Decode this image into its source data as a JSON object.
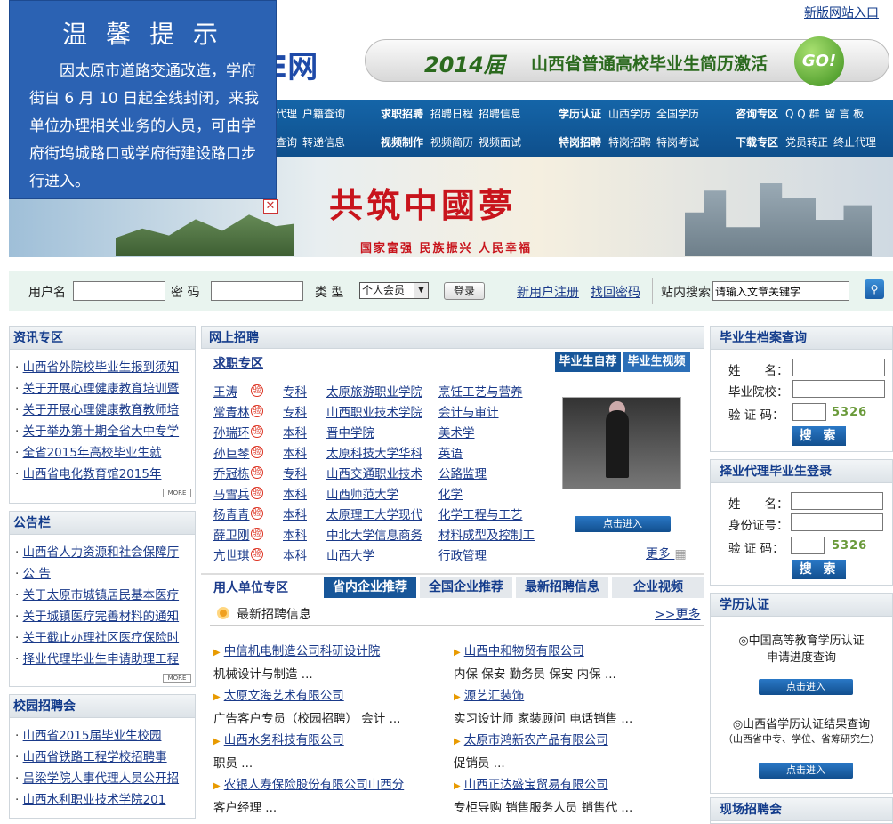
{
  "top_link": "新版网站入口",
  "logo_fragment": "E网",
  "banner": {
    "year": "2014届",
    "text": "山西省普通高校毕业生简历激活",
    "go": "GO!"
  },
  "nav": {
    "g1": {
      "r1": [
        "代理",
        "户籍查询"
      ],
      "r2": [
        "查询",
        "转递信息"
      ]
    },
    "g2": {
      "h1": "求职招聘",
      "r1": [
        "招聘日程",
        "招聘信息"
      ],
      "h2": "视频制作",
      "r2": [
        "视频简历",
        "视频面试"
      ]
    },
    "g3": {
      "h1": "学历认证",
      "r1": [
        "山西学历",
        "全国学历"
      ],
      "h2": "特岗招聘",
      "r2": [
        "特岗招聘",
        "特岗考试"
      ]
    },
    "g4": {
      "h1": "咨询专区",
      "r1": [
        "Q Q 群",
        "留 言 板"
      ],
      "h2": "下载专区",
      "r2": [
        "党员转正",
        "终止代理"
      ]
    }
  },
  "dream": {
    "title": "共筑中國夢",
    "slogan": "国家富强  民族振兴  人民幸福"
  },
  "popup": {
    "title": "温 馨 提 示",
    "message": "因太原市道路交通改造，学府街自 6 月 10 日起全线封闭，来我单位办理相关业务的人员，可由学府街坞城路口或学府街建设路口步行进入。",
    "close": "✕"
  },
  "login": {
    "user_label": "用户名",
    "pwd_label": "密 码",
    "type_label": "类 型",
    "type_value": "个人会员",
    "login_btn": "登录",
    "register": "新用户注册",
    "recover": "找回密码",
    "search_label": "站内搜索",
    "search_placeholder": "请输入文章关键字"
  },
  "news": {
    "title": "资讯专区",
    "items": [
      "山西省外院校毕业生报到须知",
      "关于开展心理健康教育培训暨",
      "关于开展心理健康教育教师培",
      "关于举办第十期全省大中专学",
      "全省2015年高校毕业生就",
      "山西省电化教育馆2015年"
    ],
    "more": "MORE"
  },
  "notice": {
    "title": "公告栏",
    "items": [
      "山西省人力资源和社会保障厅",
      "公 告",
      "关于太原市城镇居民基本医疗",
      "关于城镇医疗完善材料的通知",
      "关于截止办理社区医疗保险时",
      "择业代理毕业生申请助理工程"
    ],
    "more": "MORE"
  },
  "campus": {
    "title": "校园招聘会",
    "items": [
      "山西省2015届毕业生校园",
      "山西省铁路工程学校招聘事",
      "吕梁学院人事代理人员公开招",
      "山西水利职业技术学院201"
    ]
  },
  "recruit": {
    "title": "网上招聘",
    "sub": "求职专区",
    "tabs": [
      "毕业生自荐",
      "毕业生视频"
    ],
    "verify": "验",
    "rows": [
      [
        "王涛",
        "专科",
        "太原旅游职业学院",
        "烹饪工艺与营养"
      ],
      [
        "常青林",
        "专科",
        "山西职业技术学院",
        "会计与审计"
      ],
      [
        "孙瑞环",
        "本科",
        "晋中学院",
        "美术学"
      ],
      [
        "孙巨琴",
        "本科",
        "太原科技大学华科",
        "英语"
      ],
      [
        "乔冠栋",
        "专科",
        "山西交通职业技术",
        "公路监理"
      ],
      [
        "马雪兵",
        "本科",
        "山西师范大学",
        "化学"
      ],
      [
        "杨青青",
        "本科",
        "太原理工大学现代",
        "化学工程与工艺"
      ],
      [
        "薛卫刚",
        "本科",
        "中北大学信息商务",
        "材料成型及控制工"
      ],
      [
        "亢世琪",
        "本科",
        "山西大学",
        "行政管理"
      ]
    ],
    "enter": "点击进入",
    "more": "更多"
  },
  "employer": {
    "title": "用人单位专区",
    "tabs": [
      "省内企业推荐",
      "全国企业推荐",
      "最新招聘信息",
      "企业视频"
    ],
    "latest": "最新招聘信息",
    "more": ">>更多",
    "jobs": [
      {
        "name": "中信机电制造公司科研设计院",
        "desc": "机械设计与制造 ..."
      },
      {
        "name": "山西中和物贸有限公司",
        "desc": "内保  保安  勤务员  保安  内保 ..."
      },
      {
        "name": "太原文海艺术有限公司",
        "desc": "广告客户专员（校园招聘） 会计 ..."
      },
      {
        "name": "源艺汇装饰",
        "desc": "实习设计师  家装顾问  电话销售 ..."
      },
      {
        "name": "山西水务科技有限公司",
        "desc": "职员 ..."
      },
      {
        "name": "太原市鸿新农产品有限公司",
        "desc": "促销员 ..."
      },
      {
        "name": "农银人寿保险股份有限公司山西分",
        "desc": "客户经理 ..."
      },
      {
        "name": "山西正达盛宝贸易有限公司",
        "desc": "专柜导购  销售服务人员  销售代 ..."
      }
    ]
  },
  "archive": {
    "title": "毕业生档案查询",
    "name": "姓　　名：",
    "school": "毕业院校：",
    "code_label": "验 证 码：",
    "code": "5326",
    "btn": "搜 索"
  },
  "agent": {
    "title": "择业代理毕业生登录",
    "name": "姓　　名：",
    "id": "身份证号：",
    "code_label": "验 证 码：",
    "code": "5326",
    "btn": "搜 索"
  },
  "degree": {
    "title": "学历认证",
    "l1": "◎中国高等教育学历认证",
    "l1b": "申请进度查询",
    "enter": "点击进入",
    "l2": "◎山西省学历认证结果查询",
    "l2b": "（山西省中专、学位、省筹研究生）"
  },
  "onsite": {
    "title": "现场招聘会"
  },
  "colors": {
    "nav_blue": "#175699",
    "popup_blue": "#2b62b3",
    "link": "#1a3a8a"
  }
}
